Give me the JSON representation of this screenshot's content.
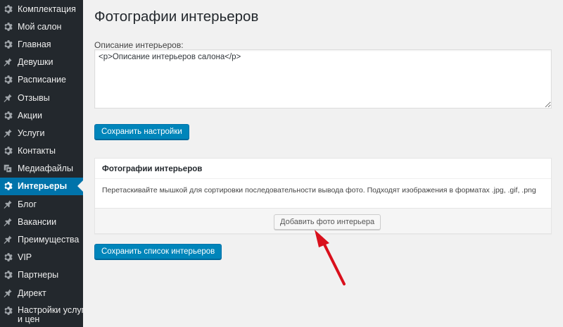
{
  "sidebar": {
    "items": [
      {
        "label": "Комплектация",
        "icon": "gear-icon"
      },
      {
        "label": "Мой салон",
        "icon": "gear-icon"
      },
      {
        "label": "Главная",
        "icon": "gear-icon"
      },
      {
        "label": "Девушки",
        "icon": "pin-icon"
      },
      {
        "label": "Расписание",
        "icon": "gear-icon"
      },
      {
        "label": "Отзывы",
        "icon": "pin-icon"
      },
      {
        "label": "Акции",
        "icon": "gear-icon"
      },
      {
        "label": "Услуги",
        "icon": "pin-icon"
      },
      {
        "label": "Контакты",
        "icon": "gear-icon"
      },
      {
        "label": "Медиафайлы",
        "icon": "media-icon"
      },
      {
        "label": "Интерьеры",
        "icon": "gear-icon",
        "active": true
      },
      {
        "label": "Блог",
        "icon": "pin-icon"
      },
      {
        "label": "Вакансии",
        "icon": "pin-icon"
      },
      {
        "label": "Преимущества",
        "icon": "pin-icon"
      },
      {
        "label": "VIP",
        "icon": "gear-icon"
      },
      {
        "label": "Партнеры",
        "icon": "gear-icon"
      },
      {
        "label": "Директ",
        "icon": "pin-icon"
      },
      {
        "label": "Настройки услуг",
        "label2": "и цен",
        "icon": "gear-icon"
      }
    ]
  },
  "main": {
    "title": "Фотографии интерьеров",
    "description_label": "Описание интерьеров:",
    "description_value": "<p>Описание интерьеров салона</p>",
    "save_settings_label": "Сохранить настройки",
    "panel": {
      "title": "Фотографии интерьеров",
      "hint": "Перетаскивайте мышкой для сортировки последовательности вывода фото. Подходят изображения в форматах .jpg, .gif, .png",
      "add_button_label": "Добавить фото интерьера"
    },
    "save_list_label": "Сохранить список интерьеров"
  },
  "colors": {
    "sidebar_bg": "#23282d",
    "active_bg": "#0073aa",
    "primary_button": "#0085ba",
    "annotation_arrow": "#d9101c"
  }
}
